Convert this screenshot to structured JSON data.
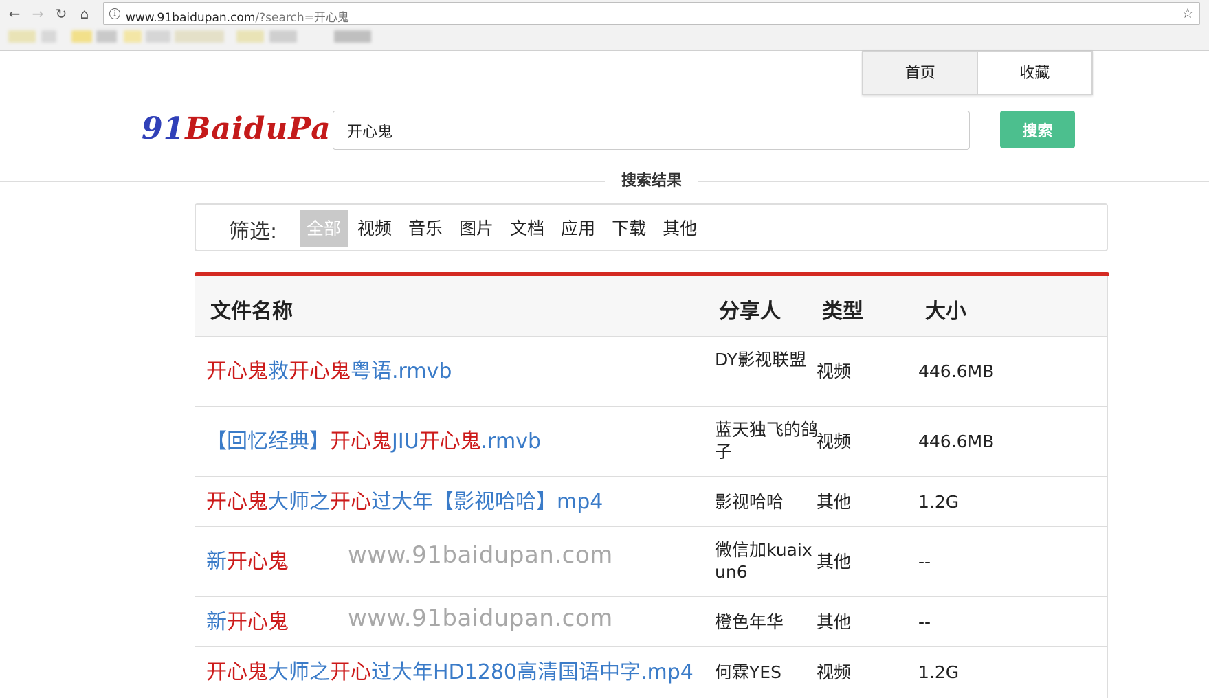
{
  "browser": {
    "url_host": "www.91baidupan.com",
    "url_path": "/?search=开心鬼"
  },
  "topnav": [
    "首页",
    "收藏"
  ],
  "logo": {
    "part1": "91",
    "part2": "Baidu",
    "part3": "Pan"
  },
  "search": {
    "value": "开心鬼",
    "button": "搜索"
  },
  "section_title": "搜索结果",
  "filter": {
    "label": "筛选:",
    "items": [
      "全部",
      "视频",
      "音乐",
      "图片",
      "文档",
      "应用",
      "下载",
      "其他"
    ],
    "active": "全部"
  },
  "table": {
    "headers": {
      "name": "文件名称",
      "sharer": "分享人",
      "type": "类型",
      "size": "大小"
    },
    "rows": [
      {
        "name_parts": [
          [
            "开心鬼",
            true
          ],
          [
            "救",
            false
          ],
          [
            "开心鬼",
            true
          ],
          [
            "粤语.rmvb",
            false
          ]
        ],
        "sharer": "DY影视联盟",
        "type": "视频",
        "size": "446.6MB"
      },
      {
        "name_parts": [
          [
            "【回忆经典】",
            false
          ],
          [
            "开心鬼",
            true
          ],
          [
            "JIU",
            false
          ],
          [
            "开心鬼",
            true
          ],
          [
            ".rmvb",
            false
          ]
        ],
        "sharer": "蓝天独飞的鸽子",
        "type": "视频",
        "size": "446.6MB"
      },
      {
        "name_parts": [
          [
            "开心鬼",
            true
          ],
          [
            "大师之",
            false
          ],
          [
            "开心",
            true
          ],
          [
            "过大年【影视哈哈】mp4",
            false
          ]
        ],
        "sharer": "影视哈哈",
        "type": "其他",
        "size": "1.2G"
      },
      {
        "name_parts": [
          [
            "新",
            false
          ],
          [
            "开心鬼",
            true
          ]
        ],
        "sharer": "微信加kuaixun6",
        "type": "其他",
        "size": "--"
      },
      {
        "name_parts": [
          [
            "新",
            false
          ],
          [
            "开心鬼",
            true
          ]
        ],
        "sharer": "橙色年华",
        "type": "其他",
        "size": "--"
      },
      {
        "name_parts": [
          [
            "开心鬼",
            true
          ],
          [
            "大师之",
            false
          ],
          [
            "开心",
            true
          ],
          [
            "过大年HD1280高清国语中字.mp4",
            false
          ]
        ],
        "sharer": "何霖YES",
        "type": "视频",
        "size": "1.2G"
      }
    ]
  },
  "watermark": "www.91baidupan.com"
}
